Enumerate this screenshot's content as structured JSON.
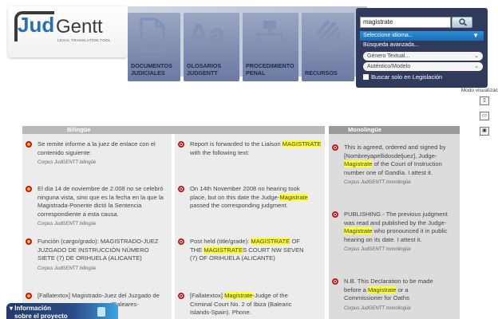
{
  "logo": {
    "brand_part1": "Jud",
    "brand_part2": "Gentt",
    "tagline": "LEGAL TRANSLATION TOOL"
  },
  "nav": [
    {
      "line1": "DOCUMENTOS",
      "line2": "JUDICIALES",
      "icon": "document-icon"
    },
    {
      "line1": "GLOSARIOS",
      "line2": "JUDGENTT",
      "icon": "glossary-icon"
    },
    {
      "line1": "PROCEDIMIENTO",
      "line2": "PENAL",
      "icon": "flowchart-icon"
    },
    {
      "line1": "RECURSOS",
      "line2": "",
      "icon": "resources-icon"
    }
  ],
  "search": {
    "value": "magistrate",
    "language_select": "Seleccione idioma...",
    "advanced_label": "Búsqueda avanzada...",
    "textual_select": "Género Textual...",
    "model_select": "Auténtico/Modelo",
    "legislation_checkbox": "Buscar solo en Legislación"
  },
  "view_mode_label": "Modo visualizac",
  "results": {
    "bilingual_header": "Bilingüe",
    "monolingual_header": "Monolingüe",
    "bilingual_rows": [
      {
        "es": [
          "Se remite informe a la juez de enlace con el",
          "contenido siguiente:"
        ],
        "en": [
          "Report is forwarded to the Liaison ",
          "MAGISTRATE",
          "with the following text:"
        ],
        "source": "Corpus JudGENTT bilingüe"
      },
      {
        "es": [
          "El día 14 de noviembre de 2.008 no se celebró",
          "ninguna vista, sino que es la fecha en la que la",
          "Magistrada-Ponente dictó la Sentencia",
          "correspondiente a esta causa."
        ],
        "en": [
          "On 14th November 2008 no hearing took",
          "place, but on this date the Judge-",
          "Magistrate",
          "passed the corresponding judgment."
        ],
        "source": "Corpus JudGENTT bilingüe"
      },
      {
        "es": [
          "Función (cargo/grado): MAGISTRADO-JUEZ",
          "JUZGADO DE INSTRUCCIÓN NÚMERO",
          "SIETE (7) DE ORIHUELA (ALICANTE)"
        ],
        "en": [
          "Post held (title/grade): ",
          "MAGISTRATE",
          " OF",
          "THE ",
          "MAGISTRATE",
          "S COURT NW SEVEN",
          "(7) OF ORIHUELA (ALICANTE)"
        ],
        "source": "Corpus JudGENTT bilingüe"
      },
      {
        "es": [
          "[Fallatextox] Magistrado-Juez del Juzgado de",
          "iza (Baleares-"
        ],
        "en": [
          "[Fallatextox] ",
          "Magistrate",
          "-Judge of the",
          "Criminal Court No. 2 of Ibiza (Balearic",
          "Islands-Spain). Phone."
        ],
        "source": ""
      }
    ],
    "monolingual_rows": [
      {
        "lines": [
          "This is agreed, ordered and signed by",
          "[Nombreyapellidosdeljuez], Judge-",
          "Magistrate",
          "of the Court of Instruction",
          "number one of Gandía. I attest it."
        ],
        "source": "Corpus JudGENTT monolingüe"
      },
      {
        "lines": [
          "PUBLISHING.- The previous judgment",
          "was read and published by the Judge-",
          "Magistrate",
          "who pronounced it in public",
          "hearing on its date. I attest it."
        ],
        "source": "Corpus JudGENTT monolingüe"
      },
      {
        "lines": [
          "N.B. This Declaration to be made",
          "before a ",
          "Magistrate",
          "or a",
          "Commissioner for Oaths"
        ],
        "source": "Corpus JudGENTT monolingüe"
      }
    ]
  },
  "info_tab": {
    "line1": "Información",
    "line2": "sobre el proyecto"
  }
}
